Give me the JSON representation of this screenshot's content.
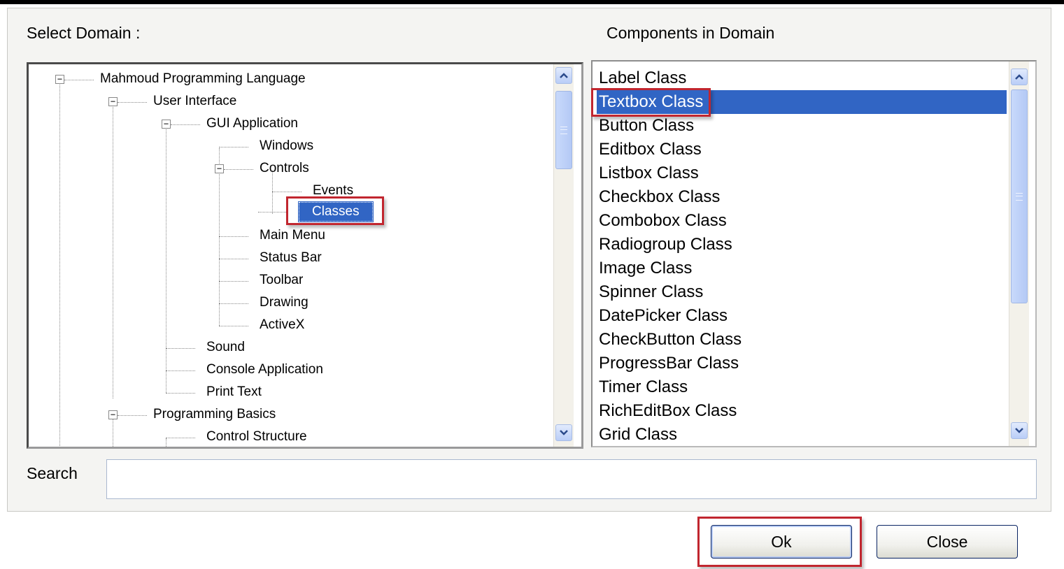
{
  "labels": {
    "select_domain": "Select Domain :",
    "components": "Components in Domain",
    "search": "Search"
  },
  "tree": [
    {
      "label": "Mahmoud Programming Language",
      "expanded": true
    },
    {
      "label": "User Interface",
      "expanded": true
    },
    {
      "label": "GUI Application",
      "expanded": true
    },
    {
      "label": "Windows"
    },
    {
      "label": "Controls",
      "expanded": true
    },
    {
      "label": "Events"
    },
    {
      "label": "Classes",
      "selected": true
    },
    {
      "label": "Main Menu"
    },
    {
      "label": "Status Bar"
    },
    {
      "label": "Toolbar"
    },
    {
      "label": "Drawing"
    },
    {
      "label": "ActiveX"
    },
    {
      "label": "Sound"
    },
    {
      "label": "Console Application"
    },
    {
      "label": "Print Text"
    },
    {
      "label": "Programming Basics",
      "expanded": true
    },
    {
      "label": "Control Structure"
    }
  ],
  "components": [
    "Label Class",
    "Textbox Class",
    "Button Class",
    "Editbox Class",
    "Listbox Class",
    "Checkbox Class",
    "Combobox Class",
    "Radiogroup Class",
    "Image Class",
    "Spinner Class",
    "DatePicker Class",
    "CheckButton Class",
    "ProgressBar Class",
    "Timer Class",
    "RichEditBox Class",
    "Grid Class"
  ],
  "selected_component": "Textbox Class",
  "search": {
    "value": "",
    "placeholder": ""
  },
  "buttons": {
    "ok": "Ok",
    "close": "Close"
  },
  "colors": {
    "selection": "#3165c4",
    "highlight": "#c1262f"
  }
}
